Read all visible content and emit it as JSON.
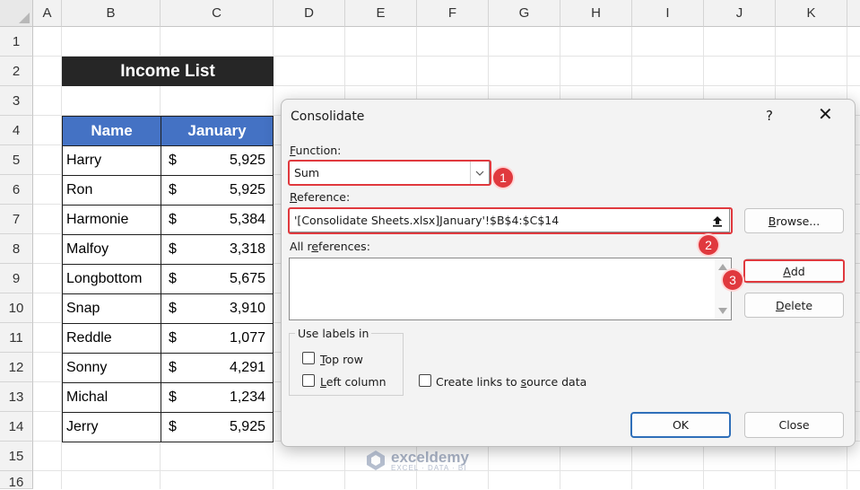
{
  "sheet": {
    "columns": [
      "A",
      "B",
      "C",
      "D",
      "E",
      "F",
      "G",
      "H",
      "I",
      "J",
      "K"
    ],
    "rows": [
      "1",
      "2",
      "3",
      "4",
      "5",
      "6",
      "7",
      "8",
      "9",
      "10",
      "11",
      "12",
      "13",
      "14",
      "15",
      "16"
    ]
  },
  "table": {
    "title": "Income List",
    "headers": [
      "Name",
      "January"
    ],
    "currency": "$",
    "rows": [
      {
        "name": "Harry",
        "amount": "5,925"
      },
      {
        "name": "Ron",
        "amount": "5,925"
      },
      {
        "name": "Harmonie",
        "amount": "5,384"
      },
      {
        "name": "Malfoy",
        "amount": "3,318"
      },
      {
        "name": "Longbottom",
        "amount": "5,675"
      },
      {
        "name": "Snap",
        "amount": "3,910"
      },
      {
        "name": "Reddle",
        "amount": "1,077"
      },
      {
        "name": "Sonny",
        "amount": "4,291"
      },
      {
        "name": "Michal",
        "amount": "1,234"
      },
      {
        "name": "Jerry",
        "amount": "5,925"
      }
    ]
  },
  "dialog": {
    "title": "Consolidate",
    "help": "?",
    "close": "✕",
    "function_label": {
      "mnemonic": "F",
      "rest": "unction:"
    },
    "function_value": "Sum",
    "reference_label": {
      "mnemonic": "R",
      "rest": "eference:"
    },
    "reference_value": "'[Consolidate Sheets.xlsx]January'!$B$4:$C$14",
    "browse": {
      "mnemonic": "B",
      "rest": "rowse..."
    },
    "all_references_label": {
      "pre": "All r",
      "mnemonic": "e",
      "rest": "ferences:"
    },
    "add": {
      "mnemonic": "A",
      "rest": "dd"
    },
    "delete": {
      "mnemonic": "D",
      "rest": "elete"
    },
    "use_labels_in": "Use labels in",
    "top_row": {
      "mnemonic": "T",
      "rest": "op row"
    },
    "left_column": {
      "mnemonic": "L",
      "rest": "eft column"
    },
    "create_links": {
      "pre": "Create links to ",
      "mnemonic": "s",
      "rest": "ource data"
    },
    "ok": "OK",
    "cancel": "Close"
  },
  "callouts": [
    "1",
    "2",
    "3"
  ],
  "watermark": {
    "name": "exceldemy",
    "tagline": "EXCEL · DATA · BI"
  },
  "colors": {
    "header_blue": "#4472c4",
    "title_dark": "#262626",
    "callout_red": "#e0393e"
  }
}
